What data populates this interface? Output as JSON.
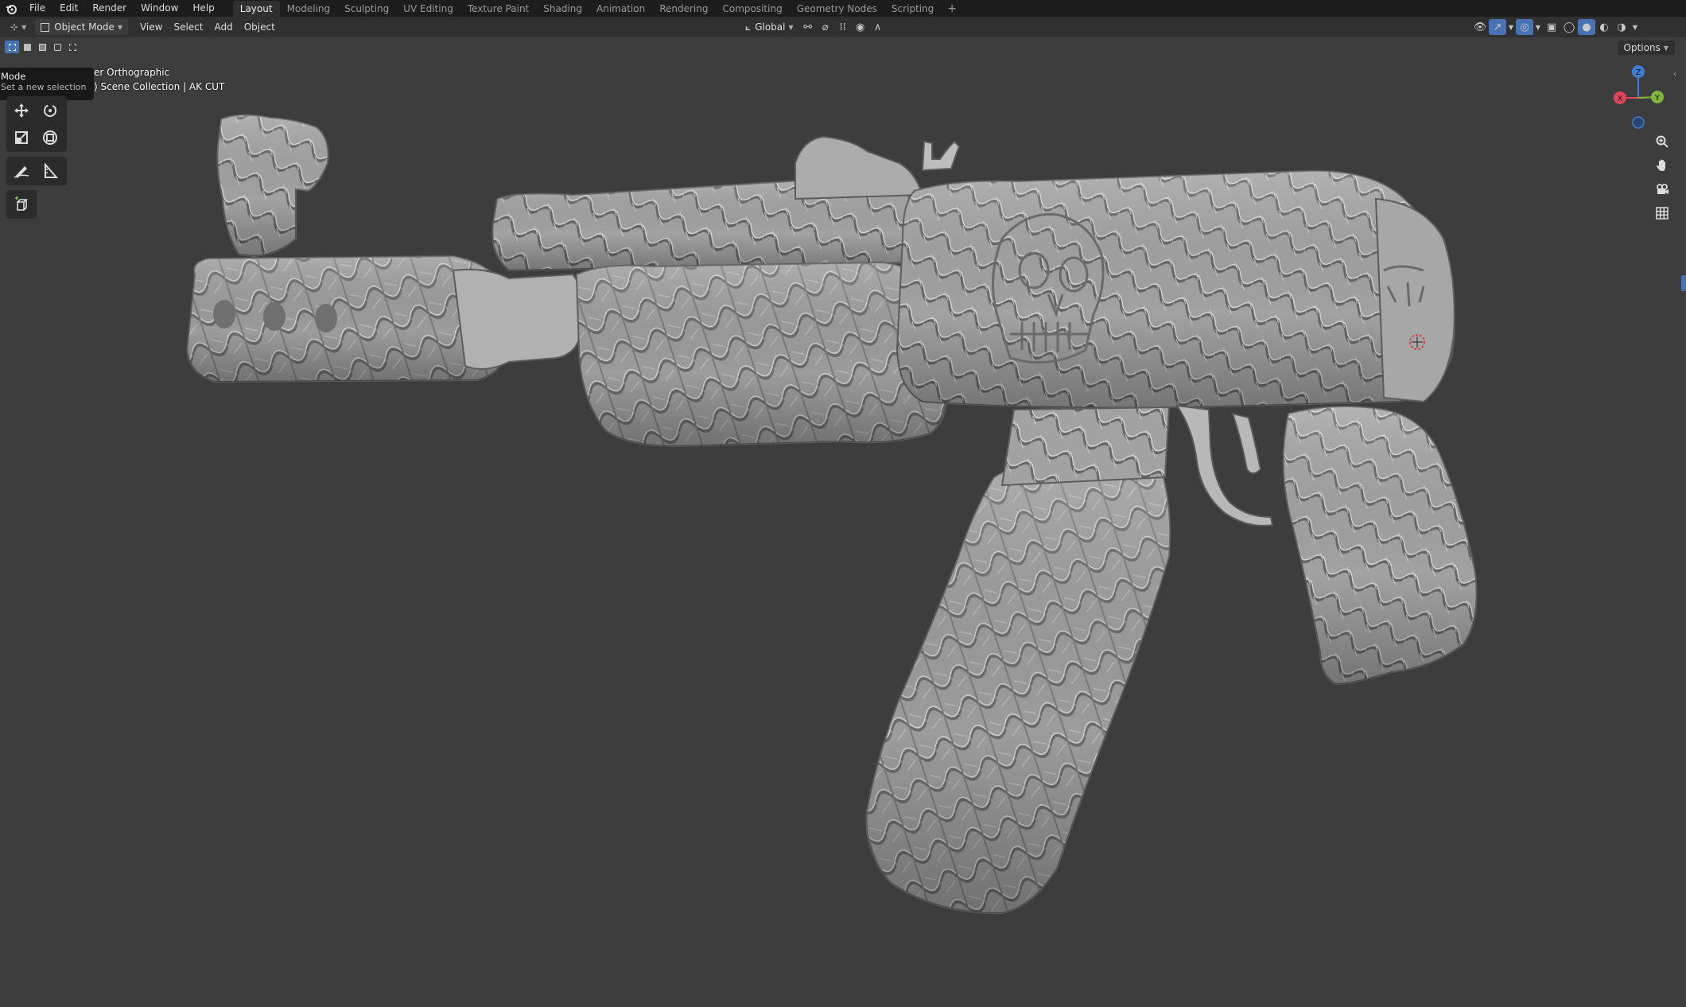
{
  "topbar": {
    "menus": [
      "File",
      "Edit",
      "Render",
      "Window",
      "Help"
    ],
    "workspaces": [
      "Layout",
      "Modeling",
      "Sculpting",
      "UV Editing",
      "Texture Paint",
      "Shading",
      "Animation",
      "Rendering",
      "Compositing",
      "Geometry Nodes",
      "Scripting"
    ],
    "active_workspace": "Layout",
    "add_tab": "+"
  },
  "header": {
    "mode": "Object Mode",
    "menus": [
      "View",
      "Select",
      "Add",
      "Object"
    ],
    "orientation": "Global",
    "options": "Options"
  },
  "tooltip": {
    "title": "Mode",
    "description": "Set a new selection"
  },
  "overlay": {
    "view_name": "er Orthographic",
    "collection": ") Scene Collection | AK CUT"
  },
  "gizmo": {
    "z_label": "Z",
    "y_label": "Y",
    "x_label": "X"
  },
  "colors": {
    "accent": "#4772b3",
    "axis_x": "#e0435a",
    "axis_y": "#7fb83a",
    "axis_z": "#3d7fd8",
    "model": "#a8a8a8",
    "viewport_bg": "#3d3d3d"
  }
}
